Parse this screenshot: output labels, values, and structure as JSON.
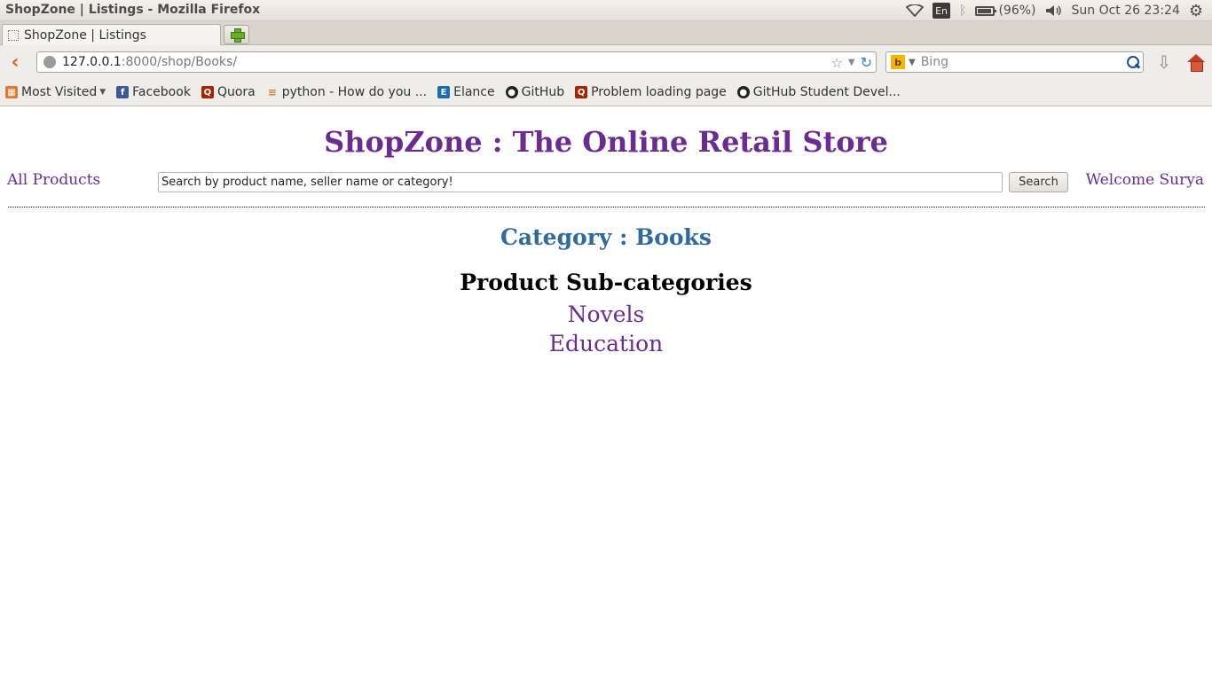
{
  "system": {
    "window_title": "ShopZone | Listings - Mozilla Firefox",
    "keyboard_layout": "En",
    "battery": "(96%)",
    "battery_level": 0.96,
    "datetime": "Sun Oct 26 23:24"
  },
  "browser": {
    "tab_title": "ShopZone | Listings",
    "url_host": "127.0.0.1",
    "url_path": ":8000/shop/Books/",
    "search_engine": "b",
    "search_placeholder": "Bing",
    "bookmarks": [
      {
        "label": "Most Visited",
        "icon": "most-visited-icon"
      },
      {
        "label": "Facebook",
        "icon": "facebook-icon"
      },
      {
        "label": "Quora",
        "icon": "quora-icon"
      },
      {
        "label": "python - How do you ...",
        "icon": "stackoverflow-icon"
      },
      {
        "label": "Elance",
        "icon": "elance-icon"
      },
      {
        "label": "GitHub",
        "icon": "github-icon"
      },
      {
        "label": "Problem loading page",
        "icon": "quora-icon"
      },
      {
        "label": "GitHub Student Devel...",
        "icon": "github-icon"
      }
    ]
  },
  "site": {
    "title": "ShopZone : The Online Retail Store",
    "all_products": "All Products",
    "search_value": "Search by product name, seller name or category!",
    "search_button": "Search",
    "welcome": "Welcome Surya",
    "category_heading": "Category : Books",
    "subcategories_heading": "Product Sub-categories",
    "subcategories": [
      "Novels",
      "Education"
    ]
  },
  "colors": {
    "brand_purple": "#6b2c91",
    "category_blue": "#2f6b9c"
  }
}
